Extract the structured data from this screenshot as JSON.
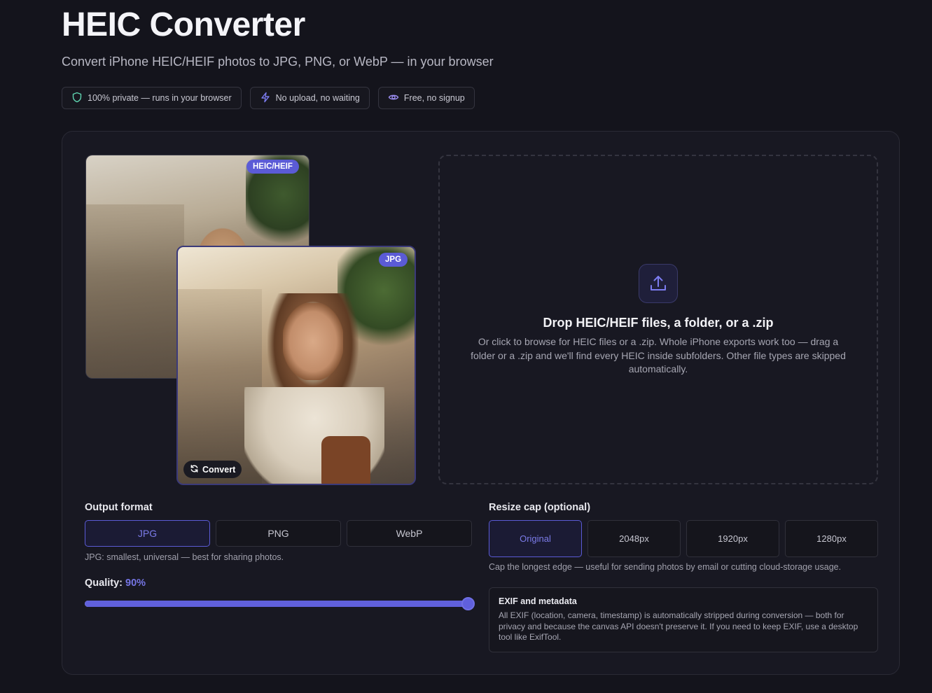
{
  "header": {
    "title": "HEIC Converter",
    "subtitle": "Convert iPhone HEIC/HEIF photos to JPG, PNG, or WebP — in your browser",
    "badges": [
      {
        "icon": "shield-icon",
        "label": "100% private — runs in your browser"
      },
      {
        "icon": "lightning-icon",
        "label": "No upload, no waiting"
      },
      {
        "icon": "eye-icon",
        "label": "Free, no signup"
      }
    ]
  },
  "preview": {
    "source_tag": "HEIC/HEIF",
    "output_tag": "JPG",
    "convert_label": "Convert"
  },
  "dropzone": {
    "icon": "upload-icon",
    "title": "Drop HEIC/HEIF files, a folder, or a .zip",
    "description": "Or click to browse for HEIC files or a .zip. Whole iPhone exports work too — drag a folder or a .zip and we'll find every HEIC inside subfolders. Other file types are skipped automatically."
  },
  "output_format": {
    "label": "Output format",
    "options": [
      "JPG",
      "PNG",
      "WebP"
    ],
    "selected": "JPG",
    "note": "JPG: smallest, universal — best for sharing photos."
  },
  "quality": {
    "label": "Quality:",
    "value_text": "90%",
    "value": 90
  },
  "resize": {
    "label": "Resize cap (optional)",
    "options": [
      "Original",
      "2048px",
      "1920px",
      "1280px"
    ],
    "selected": "Original",
    "note": "Cap the longest edge — useful for sending photos by email or cutting cloud-storage usage."
  },
  "exif": {
    "title": "EXIF and metadata",
    "body": "All EXIF (location, camera, timestamp) is automatically stripped during conversion — both for privacy and because the canvas API doesn't preserve it. If you need to keep EXIF, use a desktop tool like ExifTool."
  },
  "colors": {
    "accent": "#5b5bd6",
    "background": "#14141c",
    "panel": "#181822"
  }
}
